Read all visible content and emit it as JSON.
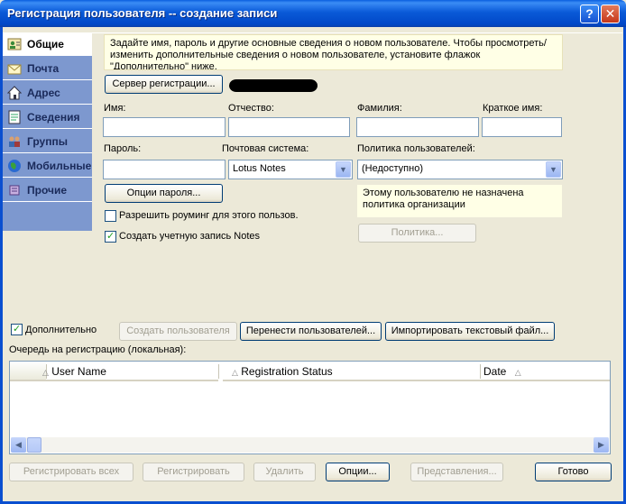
{
  "window": {
    "title": "Регистрация пользователя -- создание записи",
    "help_label": "?",
    "close_label": "✕"
  },
  "sidebar": {
    "items": [
      {
        "label": "Общие",
        "icon": "person-card-icon",
        "active": true
      },
      {
        "label": "Почта",
        "icon": "envelope-icon"
      },
      {
        "label": "Адрес",
        "icon": "house-icon"
      },
      {
        "label": "Сведения",
        "icon": "details-icon"
      },
      {
        "label": "Группы",
        "icon": "group-icon"
      },
      {
        "label": "Мобильные",
        "icon": "globe-icon"
      },
      {
        "label": "Прочие",
        "icon": "misc-icon"
      }
    ]
  },
  "general": {
    "info_text": "Задайте имя, пароль и другие основные сведения о новом пользователе. Чтобы просмотреть/изменить дополнительные сведения о новом пользователе, установите флажок \"Дополнительно\" ниже.",
    "server_button": "Сервер регистрации...",
    "labels": {
      "first_name": "Имя:",
      "middle_name": "Отчество:",
      "last_name": "Фамилия:",
      "short_name": "Краткое имя:",
      "password": "Пароль:",
      "mail_system": "Почтовая система:",
      "user_policy": "Политика пользователей:"
    },
    "mail_system_value": "Lotus Notes",
    "user_policy_value": "(Недоступно)",
    "password_options_button": "Опции пароля...",
    "policy_note": "Этому пользователю не назначена политика организации",
    "roaming_label": "Разрешить роуминг для этого пользов.",
    "create_notes_id_label": "Создать учетную запись Notes",
    "policy_button": "Политика..."
  },
  "bottom": {
    "advanced_label": "Дополнительно",
    "create_user_button": "Создать пользователя",
    "migrate_users_button": "Перенести пользователей...",
    "import_text_button": "Импортировать текстовый файл...",
    "queue_label": "Очередь на регистрацию (локальная):",
    "columns": [
      "User Name",
      "Registration Status",
      "Date"
    ],
    "register_all_button": "Регистрировать всех",
    "register_button": "Регистрировать",
    "delete_button": "Удалить",
    "options_button": "Опции...",
    "views_button": "Представления...",
    "done_button": "Готово"
  }
}
